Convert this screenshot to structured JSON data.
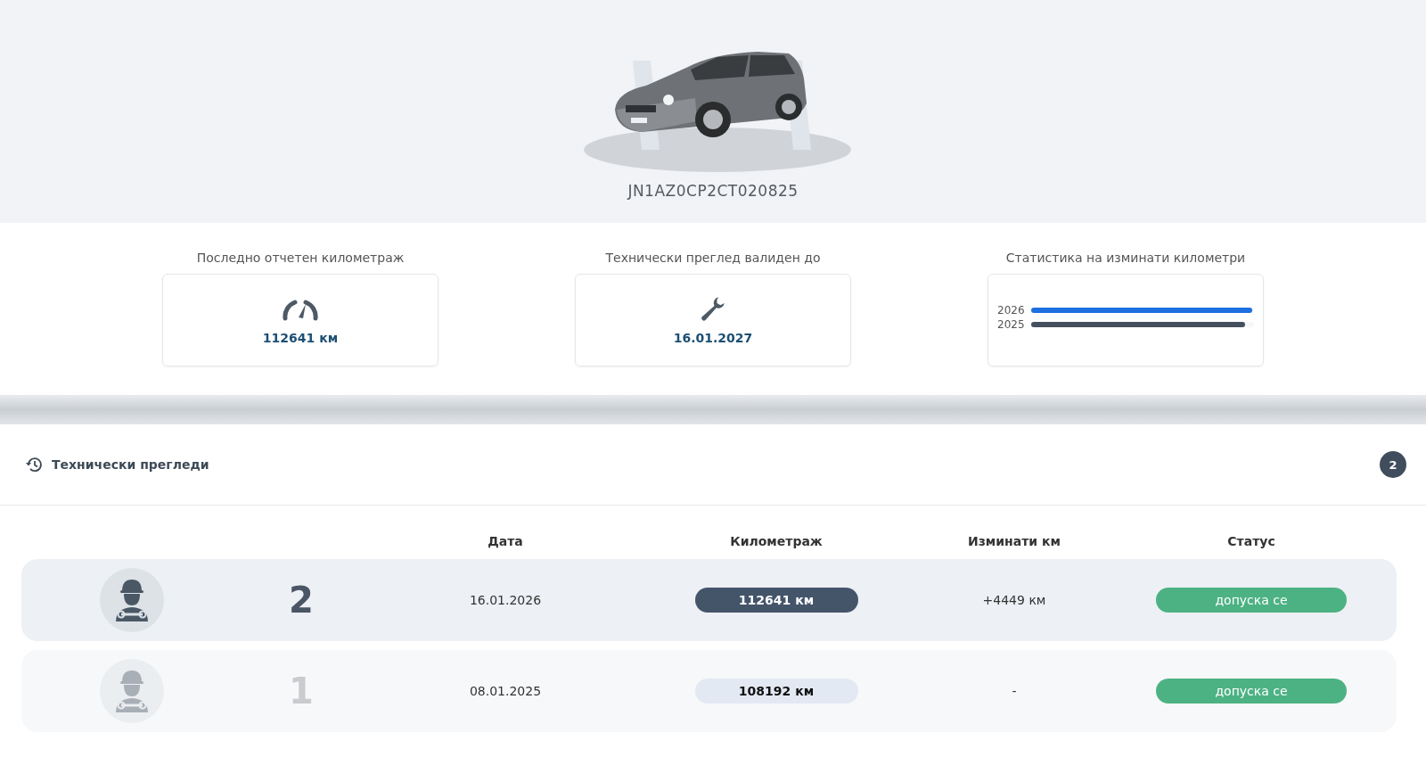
{
  "vehicle": {
    "vin": "JN1AZ0CP2CT020825"
  },
  "stats": [
    {
      "kind": "mileage",
      "title": "Последно отчетен километраж",
      "value": "112641 км"
    },
    {
      "kind": "inspection",
      "title": "Технически преглед валиден до",
      "value": "16.01.2027"
    },
    {
      "kind": "chart",
      "title": "Статистика на изминати километри",
      "bars": [
        {
          "label": "2026",
          "level": 0.99,
          "color": "#1e6fe0"
        },
        {
          "label": "2025",
          "level": 0.96,
          "color": "#44505e"
        }
      ]
    }
  ],
  "inspections": {
    "title": "Технически прегледи",
    "count": "2",
    "columns": [
      "Дата",
      "Километраж",
      "Изминати км",
      "Статус"
    ],
    "rows": [
      {
        "active": true,
        "number": "2",
        "date": "16.01.2026",
        "mileage": "112641 км",
        "driven": "+4449 км",
        "status": "допуска се"
      },
      {
        "active": false,
        "number": "1",
        "date": "08.01.2025",
        "mileage": "108192 км",
        "driven": "-",
        "status": "допуска се"
      }
    ]
  }
}
